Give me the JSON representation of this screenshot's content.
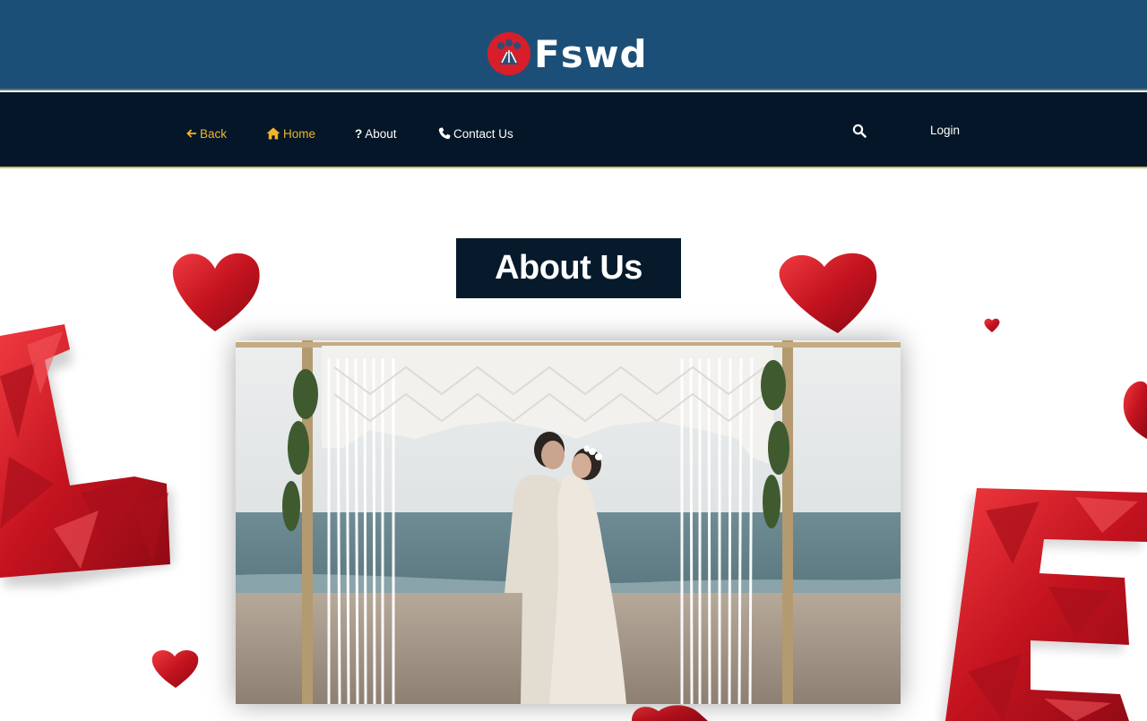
{
  "brand": {
    "name": "Fswd",
    "mark_color": "#d81e2a"
  },
  "nav": {
    "back": {
      "label": "Back",
      "icon": "arrow-left-icon"
    },
    "home": {
      "label": "Home",
      "icon": "home-icon"
    },
    "about": {
      "label": "About",
      "icon": "question-icon"
    },
    "contact": {
      "label": "Contact Us",
      "icon": "phone-icon"
    },
    "search": {
      "icon": "search-icon"
    },
    "login": {
      "label": "Login"
    }
  },
  "main": {
    "heading": "About Us",
    "image": {
      "subject": "wedding couple embracing under macrame arch on a beach"
    }
  },
  "colors": {
    "header_bg": "#1c4f78",
    "nav_bg": "#041627",
    "accent": "#f0b52a",
    "heading_bg": "#071a2b",
    "heart_red": "#d42330"
  }
}
